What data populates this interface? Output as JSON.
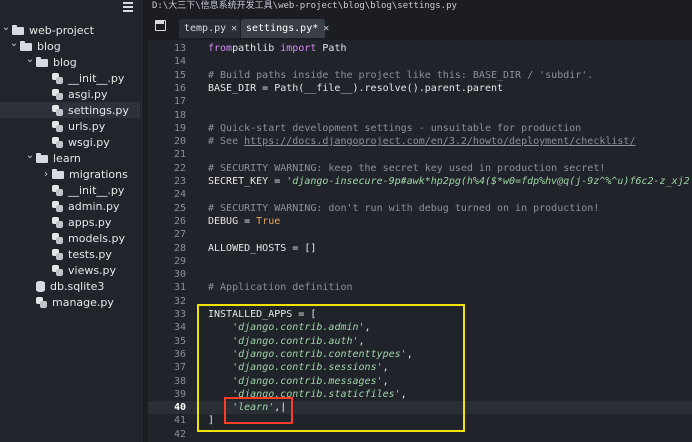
{
  "titlebar": {
    "path": "D:\\大三下\\信息系统开发工具\\web-project\\blog\\blog\\settings.py"
  },
  "tabs": [
    {
      "label": "temp.py",
      "active": false
    },
    {
      "label": "settings.py*",
      "active": true
    }
  ],
  "sidebar": {
    "items": [
      {
        "label": "web-project",
        "kind": "folder",
        "expanded": true
      },
      {
        "label": "blog",
        "kind": "folder",
        "expanded": true
      },
      {
        "label": "blog",
        "kind": "folder",
        "expanded": true
      },
      {
        "label": "__init__.py",
        "kind": "py"
      },
      {
        "label": "asgi.py",
        "kind": "py"
      },
      {
        "label": "settings.py",
        "kind": "py",
        "selected": true
      },
      {
        "label": "urls.py",
        "kind": "py"
      },
      {
        "label": "wsgi.py",
        "kind": "py"
      },
      {
        "label": "learn",
        "kind": "folder",
        "expanded": true
      },
      {
        "label": "migrations",
        "kind": "folder",
        "expanded": false
      },
      {
        "label": "__init__.py",
        "kind": "py"
      },
      {
        "label": "admin.py",
        "kind": "py"
      },
      {
        "label": "apps.py",
        "kind": "py"
      },
      {
        "label": "models.py",
        "kind": "py"
      },
      {
        "label": "tests.py",
        "kind": "py"
      },
      {
        "label": "views.py",
        "kind": "py"
      },
      {
        "label": "db.sqlite3",
        "kind": "db"
      },
      {
        "label": "manage.py",
        "kind": "py"
      }
    ]
  },
  "editor": {
    "current_line": "40",
    "lines": [
      {
        "n": "13",
        "t": [
          [
            "kw",
            "from"
          ],
          [
            "",
            "pathlib "
          ],
          [
            "kw",
            "import"
          ],
          [
            "",
            " Path"
          ]
        ]
      },
      {
        "n": "14",
        "t": []
      },
      {
        "n": "15",
        "t": [
          [
            "cm",
            "# Build paths inside the project like this: BASE_DIR / 'subdir'."
          ]
        ]
      },
      {
        "n": "16",
        "t": [
          [
            "",
            "BASE_DIR = Path(__file__).resolve().parent.parent"
          ]
        ]
      },
      {
        "n": "17",
        "t": []
      },
      {
        "n": "18",
        "t": []
      },
      {
        "n": "19",
        "t": [
          [
            "cm",
            "# Quick-start development settings - unsuitable for production"
          ]
        ]
      },
      {
        "n": "20",
        "t": [
          [
            "cm",
            "# See "
          ],
          [
            "lnk",
            "https://docs.djangoproject.com/en/3.2/howto/deployment/checklist/"
          ]
        ]
      },
      {
        "n": "21",
        "t": []
      },
      {
        "n": "22",
        "t": [
          [
            "cm",
            "# SECURITY WARNING: keep the secret key used in production secret!"
          ]
        ]
      },
      {
        "n": "23",
        "t": [
          [
            "",
            "SECRET_KEY = "
          ],
          [
            "str",
            "'django-insecure-9p#awk*hp2pg(h%4($*w0=fdp%hv@q(j-9z^%^u)f6c2-z_xj2'"
          ]
        ]
      },
      {
        "n": "24",
        "t": []
      },
      {
        "n": "25",
        "t": [
          [
            "cm",
            "# SECURITY WARNING: don't run with debug turned on in production!"
          ]
        ]
      },
      {
        "n": "26",
        "t": [
          [
            "",
            "DEBUG = "
          ],
          [
            "bool",
            "True"
          ]
        ]
      },
      {
        "n": "27",
        "t": []
      },
      {
        "n": "28",
        "t": [
          [
            "",
            "ALLOWED_HOSTS = []"
          ]
        ]
      },
      {
        "n": "29",
        "t": []
      },
      {
        "n": "30",
        "t": []
      },
      {
        "n": "31",
        "t": [
          [
            "cm",
            "# Application definition"
          ]
        ]
      },
      {
        "n": "32",
        "t": []
      },
      {
        "n": "33",
        "t": [
          [
            "",
            "INSTALLED_APPS = ["
          ]
        ]
      },
      {
        "n": "34",
        "t": [
          [
            "",
            "    "
          ],
          [
            "str",
            "'django.contrib.admin'"
          ],
          [
            "",
            ","
          ]
        ]
      },
      {
        "n": "35",
        "t": [
          [
            "",
            "    "
          ],
          [
            "str",
            "'django.contrib.auth'"
          ],
          [
            "",
            ","
          ]
        ]
      },
      {
        "n": "36",
        "t": [
          [
            "",
            "    "
          ],
          [
            "str",
            "'django.contrib.contenttypes'"
          ],
          [
            "",
            ","
          ]
        ]
      },
      {
        "n": "37",
        "t": [
          [
            "",
            "    "
          ],
          [
            "str",
            "'django.contrib.sessions'"
          ],
          [
            "",
            ","
          ]
        ]
      },
      {
        "n": "38",
        "t": [
          [
            "",
            "    "
          ],
          [
            "str",
            "'django.contrib.messages'"
          ],
          [
            "",
            ","
          ]
        ]
      },
      {
        "n": "39",
        "t": [
          [
            "",
            "    "
          ],
          [
            "str",
            "'django.contrib.staticfiles'"
          ],
          [
            "",
            ","
          ]
        ]
      },
      {
        "n": "40",
        "t": [
          [
            "",
            "    "
          ],
          [
            "str",
            "'learn'"
          ],
          [
            "",
            ",|"
          ]
        ]
      },
      {
        "n": "41",
        "t": [
          [
            "",
            "]"
          ]
        ]
      },
      {
        "n": "42",
        "t": []
      }
    ]
  },
  "colors": {
    "highlight_box": "#f0e400",
    "annotation_box": "#ff3c28"
  }
}
